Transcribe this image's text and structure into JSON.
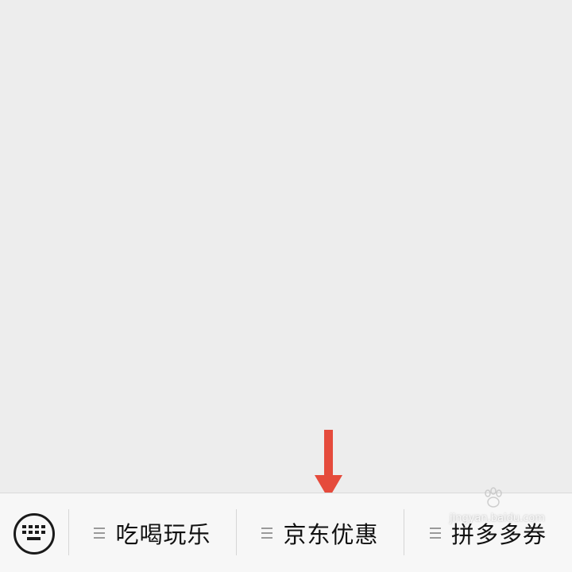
{
  "chat": {},
  "menu_bar": {
    "keyboard_toggle": {
      "icon": "keyboard-icon"
    },
    "items": [
      {
        "label": "吃喝玩乐",
        "icon": "menu-lines-icon"
      },
      {
        "label": "京东优惠",
        "icon": "menu-lines-icon"
      },
      {
        "label": "拼多多券",
        "icon": "menu-lines-icon"
      }
    ]
  },
  "annotation": {
    "arrow_color": "#e54b3c",
    "direction": "down"
  },
  "watermark": {
    "text": "jingyan.baidu.com"
  },
  "colors": {
    "background": "#ededed",
    "menu_bar": "#f7f7f7",
    "text": "#111111",
    "menu_icon": "#9a9a9a"
  }
}
